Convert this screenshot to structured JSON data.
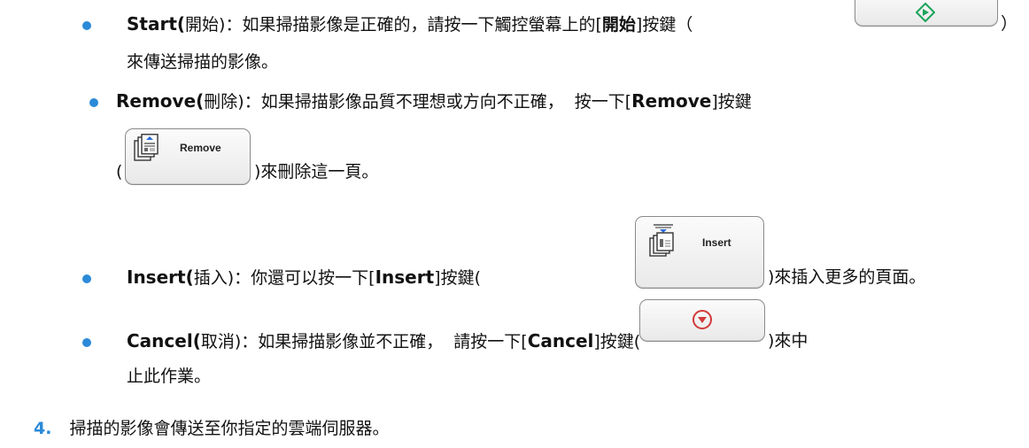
{
  "items": {
    "start": {
      "keyword": "Start(",
      "paren_zh": "開始)",
      "colon": "：",
      "text_a": "如果掃描影像是正確的，請按一下觸控螢幕上的[",
      "bracket_bold": "開始",
      "text_b": "]按鍵（",
      "close_paren": "）",
      "line2": "來傳送掃描的影像。",
      "start_icon_color": "#1aa35a"
    },
    "remove": {
      "keyword": "Remove(",
      "paren_zh": "刪除)",
      "colon": "：",
      "text_a": "如果掃描影像品質不理想或方向不正確，",
      "text_b": "按一下[",
      "bracket_bold": "Remove",
      "text_c": "]按鍵",
      "open_paren": "(",
      "button_label": "Remove",
      "after_button": ")來刪除這一頁。"
    },
    "insert": {
      "keyword": "Insert(",
      "paren_zh": "插入)",
      "colon": "：",
      "text_a": "你還可以按一下[",
      "bracket_bold": "Insert",
      "text_b": "]按鍵(",
      "button_label": "Insert",
      "after_button": ")來插入更多的頁面。"
    },
    "cancel": {
      "keyword": "Cancel(",
      "paren_zh": "取消)",
      "colon": "：",
      "text_a": "如果掃描影像並不正確，",
      "text_b": "請按一下[",
      "bracket_bold": "Cancel",
      "text_c": "]按鍵(",
      "after_button": ")來中",
      "line2": "止此作業。",
      "cancel_icon_color": "#d23a3a"
    }
  },
  "step4": {
    "number": "4.",
    "text": "掃描的影像會傳送至你指定的雲端伺服器。"
  },
  "colors": {
    "bullet": "#2b8ad8",
    "step_number": "#2b8ad8"
  }
}
